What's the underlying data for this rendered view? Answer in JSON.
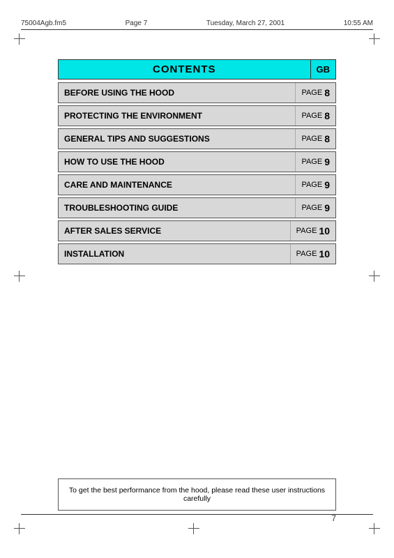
{
  "header": {
    "filename": "75004Agb.fm5",
    "page_ref": "Page 7",
    "day": "Tuesday, March 27, 2001",
    "time": "10:55 AM"
  },
  "contents": {
    "title": "CONTENTS",
    "gb_label": "GB",
    "rows": [
      {
        "label": "BEFORE USING THE HOOD",
        "page_text": "PAGE",
        "page_num": "8"
      },
      {
        "label": "PROTECTING THE ENVIRONMENT",
        "page_text": "PAGE",
        "page_num": "8"
      },
      {
        "label": "GENERAL TIPS AND SUGGESTIONS",
        "page_text": "PAGE",
        "page_num": "8"
      },
      {
        "label": "HOW TO USE THE HOOD",
        "page_text": "PAGE",
        "page_num": "9"
      },
      {
        "label": "CARE AND MAINTENANCE",
        "page_text": "PAGE",
        "page_num": "9"
      },
      {
        "label": "TROUBLESHOOTING GUIDE",
        "page_text": "PAGE",
        "page_num": "9"
      },
      {
        "label": "AFTER SALES SERVICE",
        "page_text": "PAGE",
        "page_num": "10"
      },
      {
        "label": "INSTALLATION",
        "page_text": "PAGE",
        "page_num": "10"
      }
    ]
  },
  "bottom_note": "To get the best performance from the hood, please read these user instructions carefully",
  "page_number": "7"
}
